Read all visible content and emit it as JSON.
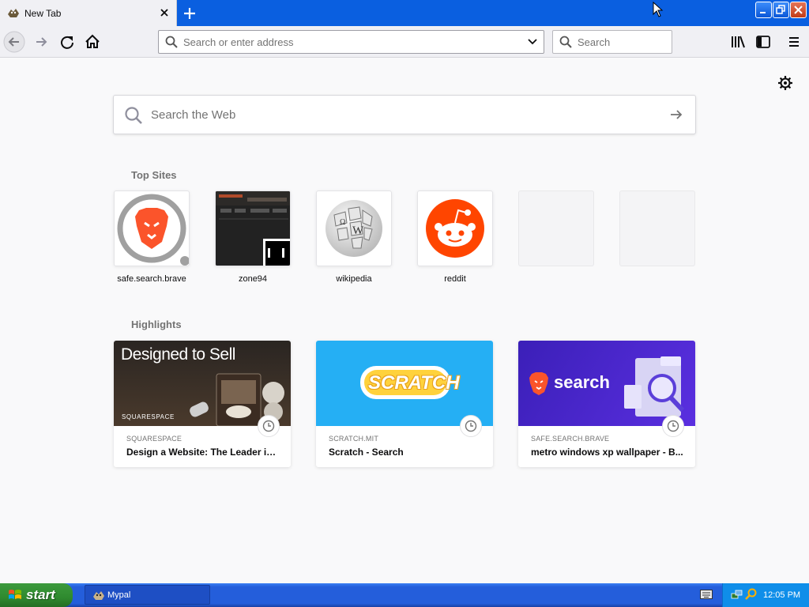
{
  "tab": {
    "title": "New Tab"
  },
  "urlbar": {
    "placeholder": "Search or enter address"
  },
  "searchbar": {
    "placeholder": "Search"
  },
  "websearch": {
    "placeholder": "Search the Web"
  },
  "top_sites": {
    "heading": "Top Sites",
    "items": [
      {
        "label": "safe.search.brave"
      },
      {
        "label": "zone94"
      },
      {
        "label": "wikipedia"
      },
      {
        "label": "reddit"
      }
    ]
  },
  "highlights": {
    "heading": "Highlights",
    "items": [
      {
        "source": "SQUARESPACE",
        "title": "Design a Website: The Leader in ...",
        "thumb_text": "Designed to Sell",
        "thumb_brand": "SQUARESPACE"
      },
      {
        "source": "SCRATCH.MIT",
        "title": "Scratch - Search",
        "thumb_text": "SCRATCH"
      },
      {
        "source": "SAFE.SEARCH.BRAVE",
        "title": "metro windows xp wallpaper - B...",
        "thumb_text": "search"
      }
    ]
  },
  "taskbar": {
    "start_label": "start",
    "task_label": "Mypal",
    "clock": "12:05 PM"
  },
  "colors": {
    "accent": "#0a5fe0",
    "brave_orange": "#fb542b",
    "reddit_orange": "#ff4500",
    "scratch_blue": "#25aff4",
    "brave_purple": "#4b23c9"
  }
}
